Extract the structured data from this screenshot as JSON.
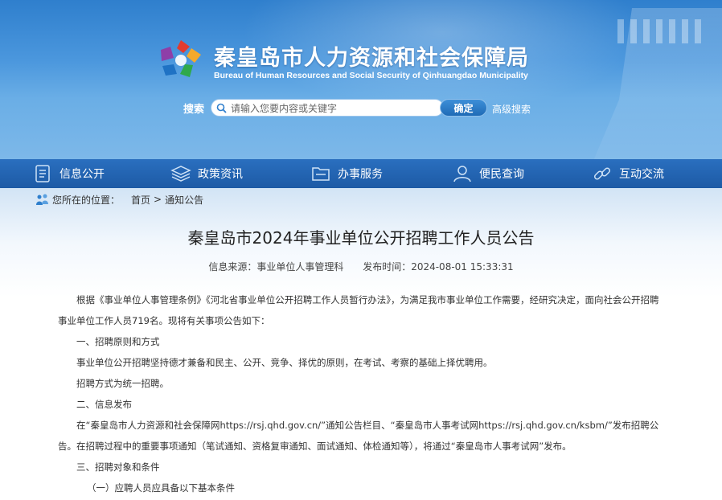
{
  "header": {
    "title": "秦皇岛市人力资源和社会保障局",
    "subtitle": "Bureau of Human Resources and Social Security of Qinhuangdao Municipality",
    "colors": {
      "primary": "#2f7fcd",
      "nav": "#1d5aa5"
    }
  },
  "search": {
    "label": "搜索",
    "placeholder": "请输入您要内容或关键字",
    "submit_label": "确定",
    "advanced_label": "高级搜索"
  },
  "nav": {
    "items": [
      {
        "label": "信息公开",
        "icon": "document-list-icon"
      },
      {
        "label": "政策资讯",
        "icon": "layers-icon"
      },
      {
        "label": "办事服务",
        "icon": "folder-icon"
      },
      {
        "label": "便民查询",
        "icon": "person-search-icon"
      },
      {
        "label": "互动交流",
        "icon": "link-icon"
      }
    ]
  },
  "breadcrumb": {
    "prefix": "您所在的位置：",
    "home": "首页",
    "separator": ">",
    "current": "通知公告"
  },
  "article": {
    "title": "秦皇岛市2024年事业单位公开招聘工作人员公告",
    "source": "信息来源：事业单位人事管理科",
    "published": "发布时间：2024-08-01 15:33:31",
    "paragraphs": [
      "根据《事业单位人事管理条例》《河北省事业单位公开招聘工作人员暂行办法》，为满足我市事业单位工作需要，经研究决定，面向社会公开招聘事业单位工作人员719名。现将有关事项公告如下：",
      "一、招聘原则和方式",
      "事业单位公开招聘坚持德才兼备和民主、公开、竞争、择优的原则，在考试、考察的基础上择优聘用。",
      "招聘方式为统一招聘。",
      "二、信息发布",
      "在“秦皇岛市人力资源和社会保障网https://rsj.qhd.gov.cn/”通知公告栏目、“秦皇岛市人事考试网https://rsj.qhd.gov.cn/ksbm/”发布招聘公告。在招聘过程中的重要事项通知（笔试通知、资格复审通知、面试通知、体检通知等），将通过“秦皇岛市人事考试网”发布。",
      "三、招聘对象和条件",
      "（一）应聘人员应具备以下基本条件"
    ]
  }
}
